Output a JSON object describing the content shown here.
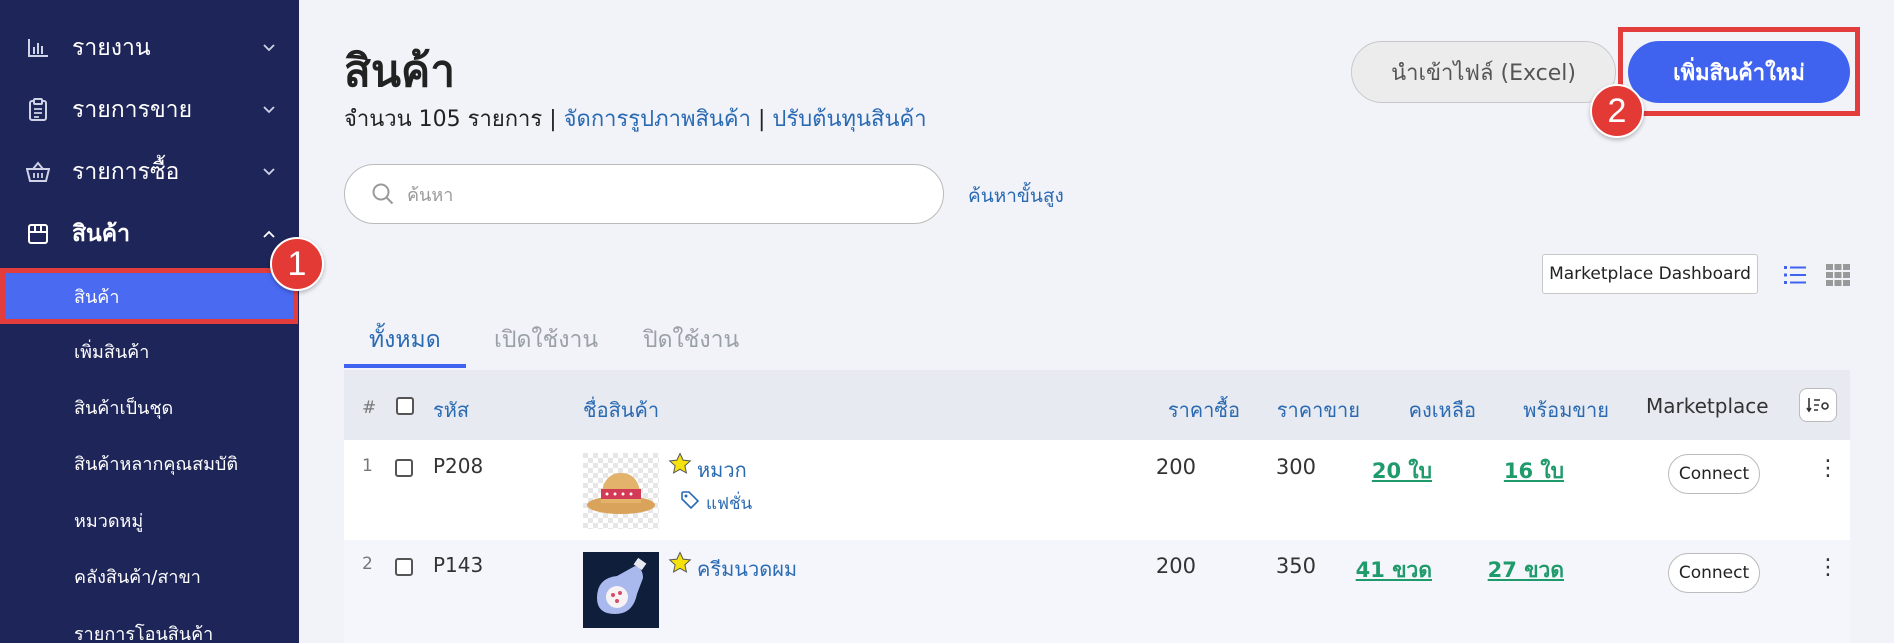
{
  "sidebar": {
    "menu": [
      {
        "label": "รายงาน",
        "icon": "bar-chart-icon"
      },
      {
        "label": "รายการขาย",
        "icon": "clipboard-icon"
      },
      {
        "label": "รายการซื้อ",
        "icon": "basket-icon"
      },
      {
        "label": "สินค้า",
        "icon": "box-icon"
      }
    ],
    "submenu": [
      "สินค้า",
      "เพิ่มสินค้า",
      "สินค้าเป็นชุด",
      "สินค้าหลากคุณสมบัติ",
      "หมวดหมู่",
      "คลังสินค้า/สาขา",
      "รายการโอนสินค้า"
    ]
  },
  "annotations": {
    "badge1": "1",
    "badge2": "2",
    "highlight_color": "#e23c3c"
  },
  "header": {
    "title": "สินค้า",
    "count_text": "จำนวน 105 รายการ",
    "sep": "|",
    "link_images": "จัดการรูปภาพสินค้า",
    "link_cost": "ปรับต้นทุนสินค้า",
    "import_button": "นำเข้าไฟล์ (Excel)",
    "add_button": "เพิ่มสินค้าใหม่"
  },
  "search": {
    "placeholder": "ค้นหา",
    "value": "",
    "advanced": "ค้นหาขั้นสูง"
  },
  "toolbar": {
    "marketplace_dashboard": "Marketplace Dashboard"
  },
  "tabs": [
    "ทั้งหมด",
    "เปิดใช้งาน",
    "ปิดใช้งาน"
  ],
  "table": {
    "headers": {
      "index": "#",
      "code": "รหัส",
      "name": "ชื่อสินค้า",
      "buy_price": "ราคาซื้อ",
      "sell_price": "ราคาขาย",
      "stock": "คงเหลือ",
      "available": "พร้อมขาย",
      "marketplace": "Marketplace"
    },
    "rows": [
      {
        "index": "1",
        "code": "P208",
        "name": "หมวก",
        "tag": "แฟชั่น",
        "buy": "200",
        "sell": "300",
        "stock": "20 ใบ",
        "available": "16 ใบ",
        "action": "Connect"
      },
      {
        "index": "2",
        "code": "P143",
        "name": "ครีมนวดผม",
        "tag": "",
        "buy": "200",
        "sell": "350",
        "stock": "41 ขวด",
        "available": "27 ขวด",
        "action": "Connect"
      }
    ]
  },
  "colors": {
    "sidebar_bg": "#1e2558",
    "accent": "#3f63ef",
    "link": "#2a6ab3",
    "stock_green": "#1f9a6a"
  }
}
